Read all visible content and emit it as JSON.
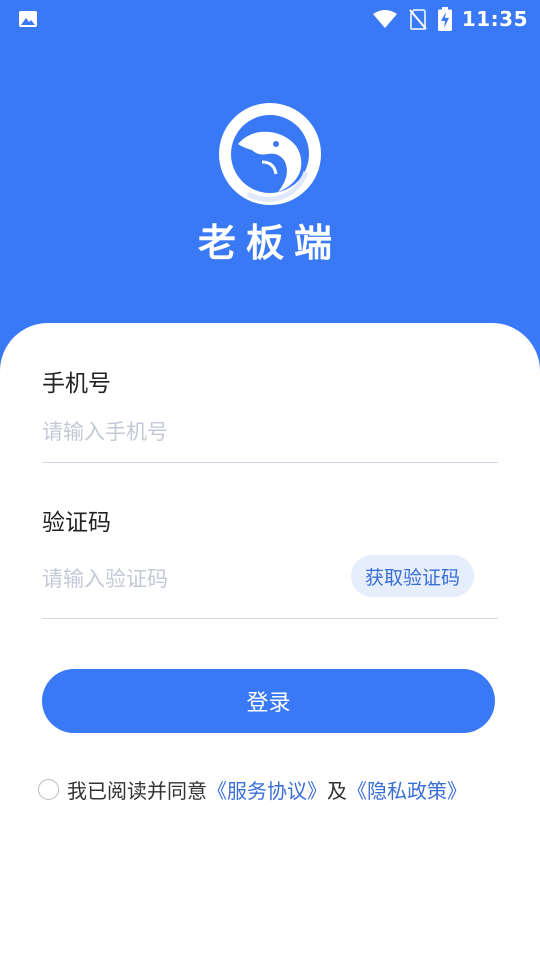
{
  "status_bar": {
    "left_icon": "image-icon",
    "icons": [
      "wifi-icon",
      "no-sim-icon",
      "battery-charging-icon"
    ],
    "time": "11:35"
  },
  "header": {
    "logo_icon": "eagle-logo-icon",
    "title": "老板端"
  },
  "form": {
    "phone": {
      "label": "手机号",
      "placeholder": "请输入手机号",
      "value": ""
    },
    "code": {
      "label": "验证码",
      "placeholder": "请输入验证码",
      "value": "",
      "button_label": "获取验证码"
    },
    "login_label": "登录"
  },
  "agreement": {
    "checked": false,
    "prefix": "我已阅读并同意",
    "service_link": "《服务协议》",
    "connector": "及",
    "privacy_link": "《隐私政策》"
  },
  "colors": {
    "primary": "#3a79f6",
    "link": "#3a6fd8",
    "placeholder": "#c4c9d6"
  }
}
